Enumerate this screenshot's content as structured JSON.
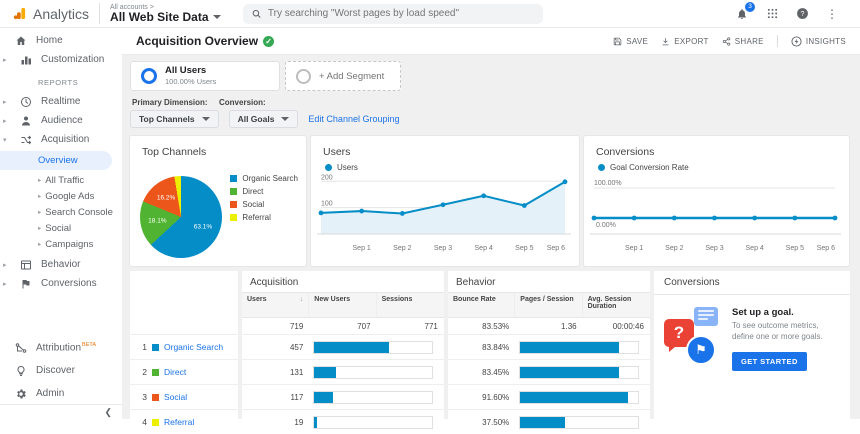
{
  "app_bar": {
    "brand": "Analytics",
    "account_breadcrumb": "All accounts >",
    "property_name": "All Web Site Data",
    "search_placeholder": "Try searching \"Worst pages by load speed\"",
    "notification_count": "3"
  },
  "sidebar": {
    "items_top": [
      {
        "label": "Home",
        "icon": "home-icon"
      },
      {
        "label": "Customization",
        "icon": "customization-icon"
      }
    ],
    "reports_label": "REPORTS",
    "report_items": [
      {
        "label": "Realtime",
        "icon": "clock-icon"
      },
      {
        "label": "Audience",
        "icon": "person-icon"
      },
      {
        "label": "Acquisition",
        "icon": "acquisition-icon"
      },
      {
        "label": "Behavior",
        "icon": "behavior-icon"
      },
      {
        "label": "Conversions",
        "icon": "flag-icon"
      }
    ],
    "acquisition_children": [
      "Overview",
      "All Traffic",
      "Google Ads",
      "Search Console",
      "Social",
      "Campaigns"
    ],
    "selected_child": "Overview",
    "footer_items": [
      {
        "label": "Attribution",
        "badge": "BETA",
        "icon": "attribution-icon"
      },
      {
        "label": "Discover",
        "badge": "",
        "icon": "lightbulb-icon"
      },
      {
        "label": "Admin",
        "badge": "",
        "icon": "gear-icon"
      }
    ]
  },
  "toolbar": {
    "title": "Acquisition Overview",
    "actions": [
      "SAVE",
      "EXPORT",
      "SHARE",
      "INSIGHTS"
    ]
  },
  "segments": {
    "all_users_title": "All Users",
    "all_users_subtitle": "100.00% Users",
    "add_segment_label": "+ Add Segment"
  },
  "dimension_bar": {
    "primary_label": "Primary Dimension:",
    "primary_value": "Top Channels",
    "conversion_label": "Conversion:",
    "conversion_value": "All Goals",
    "edit_link": "Edit Channel Grouping"
  },
  "colors": {
    "organic": "#058dc7",
    "direct": "#50b432",
    "social": "#ed561b",
    "referral": "#edef00",
    "accent_blue": "#1a73e8",
    "chart_blue": "#058dc7",
    "area_fill": "#e4f1f9"
  },
  "chart_data": [
    {
      "type": "pie",
      "title": "Top Channels",
      "labels": [
        "Organic Search",
        "Direct",
        "Social",
        "Referral"
      ],
      "values": [
        63.1,
        18.1,
        16.2,
        2.6
      ],
      "colors": [
        "#058dc7",
        "#50b432",
        "#ed561b",
        "#edef00"
      ],
      "slice_labels": [
        "63.1%",
        "18.1%",
        "16.2%",
        ""
      ],
      "legend_position": "right"
    },
    {
      "type": "area",
      "title": "Users",
      "legend": "Users",
      "x": [
        "",
        "Sep 1",
        "Sep 2",
        "Sep 3",
        "Sep 4",
        "Sep 5",
        "Sep 6"
      ],
      "values": [
        80,
        87,
        78,
        111,
        145,
        108,
        198
      ],
      "ylim": [
        0,
        220
      ],
      "yticks": [
        100,
        200
      ],
      "grid": true
    },
    {
      "type": "line",
      "title": "Conversions",
      "legend": "Goal Conversion Rate",
      "x": [
        "",
        "Sep 1",
        "Sep 2",
        "Sep 3",
        "Sep 4",
        "Sep 5",
        "Sep 6"
      ],
      "values": [
        0,
        0,
        0,
        0,
        0,
        0,
        0
      ],
      "ytick_top": "100.00%",
      "ytick_line": "0.00%",
      "grid": true
    }
  ],
  "table": {
    "group_acquisition": "Acquisition",
    "group_behavior": "Behavior",
    "group_conversions": "Conversions",
    "columns": {
      "users": "Users",
      "new_users": "New Users",
      "sessions": "Sessions",
      "bounce": "Bounce Rate",
      "pages": "Pages / Session",
      "avg": "Avg. Session Duration"
    },
    "totals": {
      "users": "719",
      "new_users": "707",
      "sessions": "771",
      "bounce": "83.53%",
      "pages": "1.36",
      "avg": "00:00:46"
    },
    "rows": [
      {
        "rank": "1",
        "channel": "Organic Search",
        "color": "#058dc7",
        "users": "457",
        "users_pct": 63.1,
        "bounce": "83.84%",
        "bounce_pct": 83.84
      },
      {
        "rank": "2",
        "channel": "Direct",
        "color": "#50b432",
        "users": "131",
        "users_pct": 18.1,
        "bounce": "83.45%",
        "bounce_pct": 83.45
      },
      {
        "rank": "3",
        "channel": "Social",
        "color": "#ed561b",
        "users": "117",
        "users_pct": 16.2,
        "bounce": "91.60%",
        "bounce_pct": 91.6
      },
      {
        "rank": "4",
        "channel": "Referral",
        "color": "#edef00",
        "users": "19",
        "users_pct": 2.6,
        "bounce": "37.50%",
        "bounce_pct": 37.5
      }
    ],
    "promo": {
      "title": "Set up a goal.",
      "description": "To see outcome metrics, define one or more goals.",
      "button": "GET STARTED"
    }
  }
}
